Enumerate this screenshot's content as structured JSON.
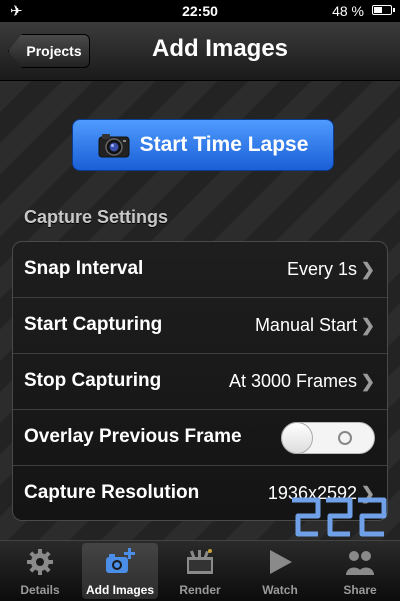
{
  "status_bar": {
    "time": "22:50",
    "battery_text": "48 %",
    "battery_level": 0.48,
    "airplane_mode": true
  },
  "nav": {
    "back_label": "Projects",
    "title": "Add Images"
  },
  "main": {
    "start_button_label": "Start Time Lapse",
    "section_title": "Capture Settings",
    "settings": [
      {
        "label": "Snap Interval",
        "value": "Every 1s"
      },
      {
        "label": "Start Capturing",
        "value": "Manual Start"
      },
      {
        "label": "Stop Capturing",
        "value": "At 3000 Frames"
      },
      {
        "label": "Overlay Previous Frame",
        "toggle": "off"
      },
      {
        "label": "Capture Resolution",
        "value": "1936x2592"
      }
    ]
  },
  "tabs": [
    {
      "label": "Details",
      "icon": "gear-icon"
    },
    {
      "label": "Add Images",
      "icon": "add-images-icon",
      "active": true
    },
    {
      "label": "Render",
      "icon": "film-icon"
    },
    {
      "label": "Watch",
      "icon": "play-icon"
    },
    {
      "label": "Share",
      "icon": "share-icon"
    }
  ],
  "colors": {
    "accent": "#2f7cf0",
    "nav_bg": "#2a2a2a"
  }
}
